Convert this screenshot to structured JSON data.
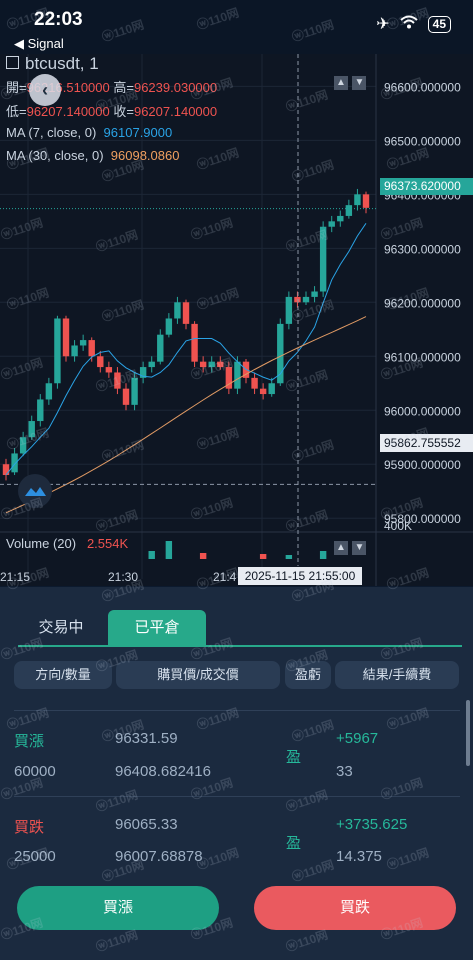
{
  "status": {
    "time": "22:03",
    "back_label": "◀ Signal",
    "battery": "45"
  },
  "chart": {
    "symbol": "btcusdt, 1",
    "open_label": "開=",
    "open": "96216.510000",
    "high_label": "高=",
    "high": "96239.030000",
    "low_label": "低=",
    "low": "96207.140000",
    "close_label": "收=",
    "close": "96207.140000",
    "ma7_label": "MA (7, close, 0)",
    "ma7": "96107.9000",
    "ma30_label": "MA (30, close, 0)",
    "ma30": "96098.0860",
    "price_ticks": [
      "96600.000000",
      "96500.000000",
      "96400.000000",
      "96300.000000",
      "96200.000000",
      "96100.000000",
      "96000.000000",
      "95900.000000",
      "95800.000000"
    ],
    "current_price": "96373.620000",
    "cursor_price": "95862.755552",
    "volume_label": "Volume (20)",
    "volume_value": "2.554K",
    "volume_tick": "400K",
    "time_ticks": [
      "21:15",
      "21:30",
      "21:4"
    ],
    "cursor_time": "2025-11-15 21:55:00"
  },
  "tabs": {
    "trading": "交易中",
    "closed": "已平倉"
  },
  "table_headers": [
    "方向/數量",
    "購買價/成交價",
    "盈虧",
    "結果/手續費"
  ],
  "trades": [
    {
      "direction": "買漲",
      "qty": "60000",
      "buy_price": "96331.59",
      "deal_price": "96408.682416",
      "pnl": "盈",
      "result": "+5967",
      "fee": "33"
    },
    {
      "direction": "買跌",
      "qty": "25000",
      "buy_price": "96065.33",
      "deal_price": "96007.68878",
      "pnl": "盈",
      "result": "+3735.625",
      "fee": "14.375"
    }
  ],
  "buttons": {
    "buy_up": "買漲",
    "buy_down": "買跌"
  },
  "colors": {
    "up": "#26a69a",
    "down": "#ef5350",
    "accent": "#27a98a"
  },
  "watermark_text": "ⓦ110网",
  "chart_data": {
    "type": "candlestick",
    "y_range": [
      95780,
      96660
    ],
    "candles": [
      {
        "o": 95900,
        "c": 95880,
        "h": 95910,
        "l": 95870
      },
      {
        "o": 95885,
        "c": 95920,
        "h": 95930,
        "l": 95880
      },
      {
        "o": 95920,
        "c": 95950,
        "h": 95960,
        "l": 95915
      },
      {
        "o": 95950,
        "c": 95980,
        "h": 95990,
        "l": 95945
      },
      {
        "o": 95980,
        "c": 96020,
        "h": 96030,
        "l": 95970
      },
      {
        "o": 96020,
        "c": 96050,
        "h": 96060,
        "l": 96010
      },
      {
        "o": 96050,
        "c": 96170,
        "h": 96175,
        "l": 96040
      },
      {
        "o": 96170,
        "c": 96100,
        "h": 96175,
        "l": 96090
      },
      {
        "o": 96100,
        "c": 96120,
        "h": 96130,
        "l": 96090
      },
      {
        "o": 96120,
        "c": 96130,
        "h": 96140,
        "l": 96110
      },
      {
        "o": 96130,
        "c": 96100,
        "h": 96135,
        "l": 96090
      },
      {
        "o": 96100,
        "c": 96080,
        "h": 96110,
        "l": 96070
      },
      {
        "o": 96080,
        "c": 96070,
        "h": 96090,
        "l": 96060
      },
      {
        "o": 96070,
        "c": 96040,
        "h": 96080,
        "l": 96030
      },
      {
        "o": 96040,
        "c": 96010,
        "h": 96050,
        "l": 96000
      },
      {
        "o": 96010,
        "c": 96060,
        "h": 96070,
        "l": 96000
      },
      {
        "o": 96060,
        "c": 96080,
        "h": 96090,
        "l": 96050
      },
      {
        "o": 96080,
        "c": 96090,
        "h": 96100,
        "l": 96070
      },
      {
        "o": 96090,
        "c": 96140,
        "h": 96150,
        "l": 96085
      },
      {
        "o": 96140,
        "c": 96170,
        "h": 96180,
        "l": 96135
      },
      {
        "o": 96170,
        "c": 96200,
        "h": 96210,
        "l": 96160
      },
      {
        "o": 96200,
        "c": 96160,
        "h": 96205,
        "l": 96150
      },
      {
        "o": 96160,
        "c": 96090,
        "h": 96165,
        "l": 96080
      },
      {
        "o": 96090,
        "c": 96080,
        "h": 96100,
        "l": 96070
      },
      {
        "o": 96080,
        "c": 96090,
        "h": 96100,
        "l": 96070
      },
      {
        "o": 96090,
        "c": 96080,
        "h": 96100,
        "l": 96075
      },
      {
        "o": 96080,
        "c": 96040,
        "h": 96090,
        "l": 96030
      },
      {
        "o": 96040,
        "c": 96090,
        "h": 96100,
        "l": 96030
      },
      {
        "o": 96090,
        "c": 96060,
        "h": 96095,
        "l": 96050
      },
      {
        "o": 96060,
        "c": 96040,
        "h": 96070,
        "l": 96030
      },
      {
        "o": 96040,
        "c": 96030,
        "h": 96050,
        "l": 96020
      },
      {
        "o": 96030,
        "c": 96050,
        "h": 96060,
        "l": 96025
      },
      {
        "o": 96050,
        "c": 96160,
        "h": 96170,
        "l": 96045
      },
      {
        "o": 96160,
        "c": 96210,
        "h": 96220,
        "l": 96150
      },
      {
        "o": 96210,
        "c": 96200,
        "h": 96220,
        "l": 96190
      },
      {
        "o": 96200,
        "c": 96210,
        "h": 96220,
        "l": 96195
      },
      {
        "o": 96210,
        "c": 96220,
        "h": 96230,
        "l": 96200
      },
      {
        "o": 96220,
        "c": 96340,
        "h": 96350,
        "l": 96210
      },
      {
        "o": 96340,
        "c": 96350,
        "h": 96360,
        "l": 96330
      },
      {
        "o": 96350,
        "c": 96360,
        "h": 96370,
        "l": 96340
      },
      {
        "o": 96360,
        "c": 96380,
        "h": 96390,
        "l": 96355
      },
      {
        "o": 96380,
        "c": 96400,
        "h": 96410,
        "l": 96370
      },
      {
        "o": 96400,
        "c": 96375,
        "h": 96405,
        "l": 96365
      }
    ]
  }
}
